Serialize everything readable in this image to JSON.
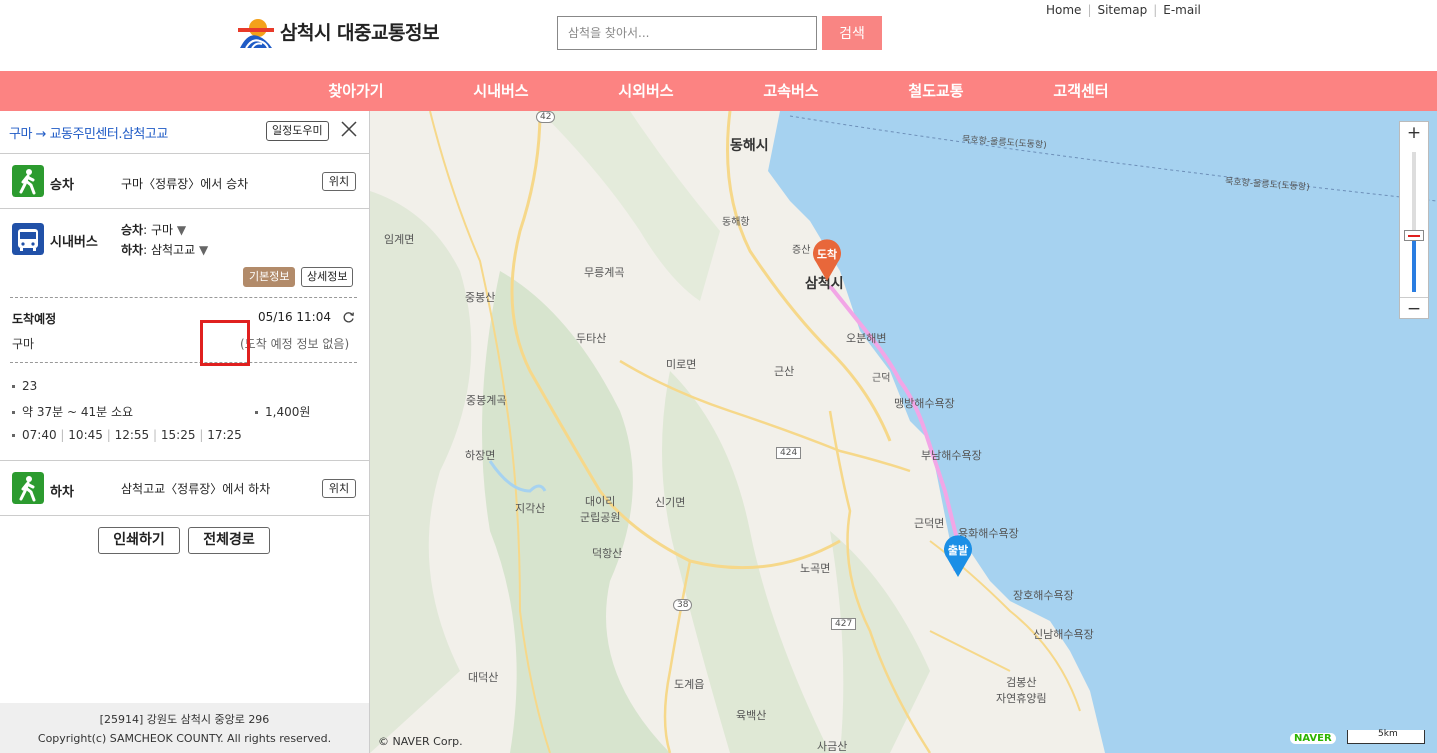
{
  "header": {
    "logo_text": "삼척시 대중교통정보",
    "search_placeholder": "삼척을 찾아서...",
    "search_button": "검색",
    "util_links": [
      "Home",
      "Sitemap",
      "E-mail"
    ]
  },
  "nav": [
    "찾아가기",
    "시내버스",
    "시외버스",
    "고속버스",
    "철도교통",
    "고객센터"
  ],
  "panel": {
    "route_title": "구마 → 교동주민센터.삼척고교",
    "help_button": "일정도우미",
    "board": {
      "label": "승차",
      "desc": "구마〈정류장〉에서 승차",
      "pos_button": "위치"
    },
    "bus": {
      "label": "시내버스",
      "board_key": "승차",
      "board_value": ": 구마",
      "alight_key": "하차",
      "alight_value": ": 삼척고교",
      "basic_info_button": "기본정보",
      "detail_button": "상세정보",
      "arrival_label": "도착예정",
      "arrival_time": "05/16 11:04",
      "stop_name": "구마",
      "arrival_note": "(도착 예정 정보 없음)",
      "route_number": "23",
      "duration": "약 37분 ~ 41분 소요",
      "fare": "1,400원",
      "times": [
        "07:40",
        "10:45",
        "12:55",
        "15:25",
        "17:25"
      ],
      "highlight_color": "#e0201f"
    },
    "alight": {
      "label": "하차",
      "desc": "삼척고교〈정류장〉에서 하차",
      "pos_button": "위치"
    },
    "print_button": "인쇄하기",
    "full_route_button": "전체경로"
  },
  "footer": {
    "address": "[25914] 강원도 삼척시 중앙로 296",
    "copyright": "Copyright(c) SAMCHEOK COUNTY. All rights reserved."
  },
  "map": {
    "labels": {
      "donghae": "동해시",
      "samcheok": "삼척시",
      "imgye": "임계면",
      "mireo": "미로면",
      "hajang": "하장면",
      "singi": "신기면",
      "geundeok": "근덕면",
      "nogok": "노곡면",
      "dogye": "도계읍",
      "mureung": "무릉계곡",
      "jungbong": "중봉산",
      "duta": "두타산",
      "geunsan": "근산",
      "jungbonggyegok": "중봉계곡",
      "jigak": "지각산",
      "daei": "대이리\n군립공원",
      "deokhang": "덕항산",
      "daedeok": "대덕산",
      "yukbaek": "육백산",
      "sageum": "사금산",
      "geombong": "검봉산\n자연휴양림",
      "obun": "오분해변",
      "maengbang": "맹방해수욕장",
      "bunam": "부남해수욕장",
      "yongpyeong": "용화해수욕장",
      "jangho": "장호해수욕장",
      "sinnam": "신남해수욕장",
      "ferry1": "묵호항-울릉도(도동항)",
      "ferry2": "묵호항-울릉도(도동항)",
      "donghaehang": "동해항",
      "jeungsan": "증산",
      "ic": "근덕",
      "road42": "42",
      "road424": "424",
      "road38": "38",
      "road427": "427"
    },
    "marker_arrive": "도착",
    "marker_depart": "출발",
    "attribution": "© NAVER Corp.",
    "naver_logo": "NAVER",
    "scale_label": "5km",
    "zoom_in": "+",
    "zoom_out": "−",
    "colors": {
      "sea": "#a6d2f0",
      "land": "#f2f0ea",
      "route": "#f2a6e6",
      "arrive": "#e8673a",
      "depart": "#1b8fe6"
    }
  }
}
